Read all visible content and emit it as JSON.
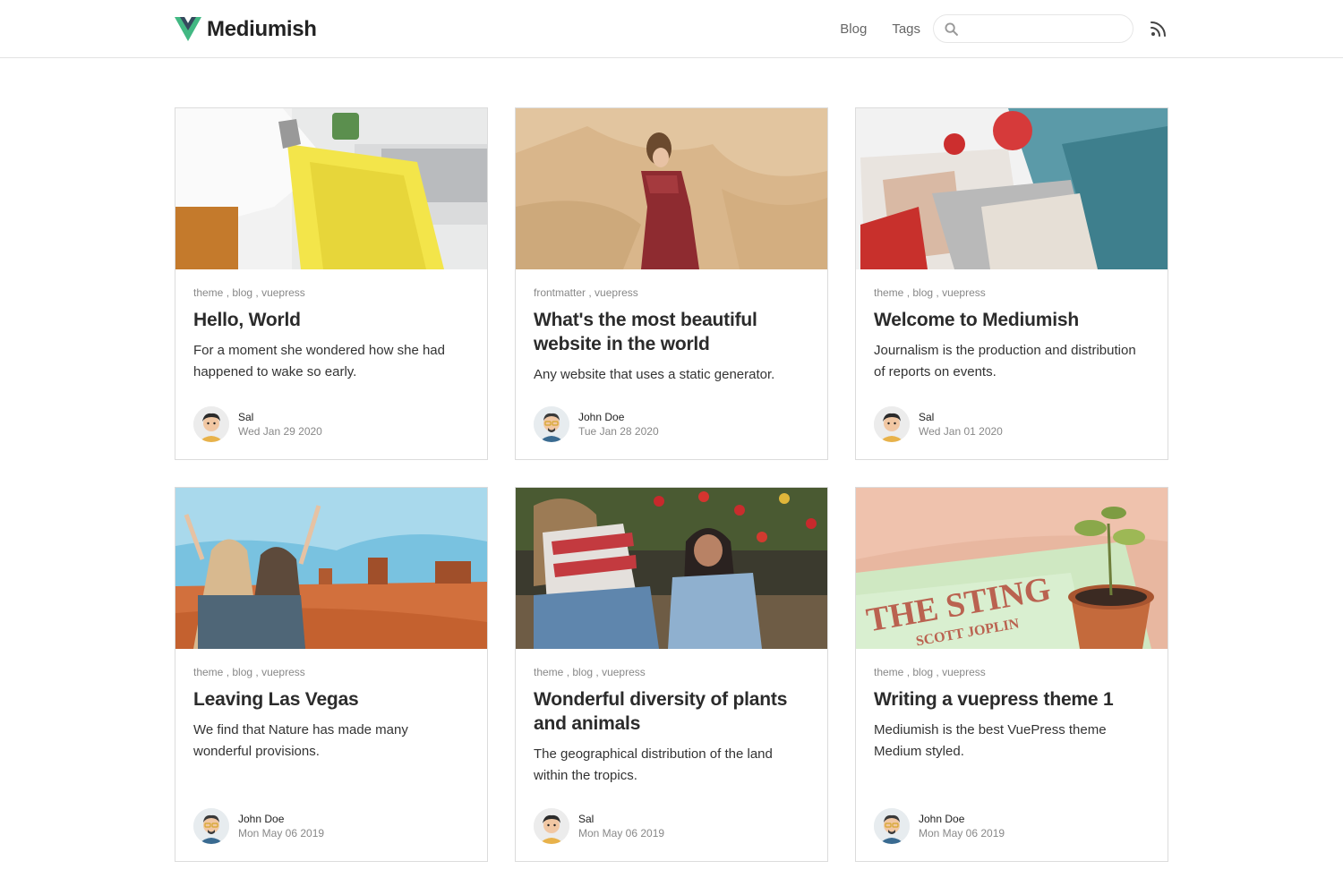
{
  "site": {
    "name": "Mediumish",
    "brand_color": "#42b883",
    "brand_dark": "#35495e"
  },
  "nav": {
    "links": [
      "Blog",
      "Tags"
    ],
    "search": {
      "value": "",
      "placeholder": ""
    },
    "rss_icon": "rss-icon"
  },
  "posts": [
    {
      "tags": [
        "theme",
        "blog",
        "vuepress"
      ],
      "title": "Hello, World",
      "excerpt": "For a moment she wondered how she had happened to wake so early.",
      "author": "Sal",
      "date": "Wed Jan 29 2020",
      "image": "person-reading-yellow-magazine"
    },
    {
      "tags": [
        "frontmatter",
        "vuepress"
      ],
      "title": "What's the most beautiful website in the world",
      "excerpt": "Any website that uses a static generator.",
      "author": "John Doe",
      "date": "Tue Jan 28 2020",
      "image": "girl-red-dress-sand-wall"
    },
    {
      "tags": [
        "theme",
        "blog",
        "vuepress"
      ],
      "title": "Welcome to Mediumish",
      "excerpt": "Journalism is the production and distribution of reports on events.",
      "author": "Sal",
      "date": "Wed Jan 01 2020",
      "image": "fashion-magazines"
    },
    {
      "tags": [
        "theme",
        "blog",
        "vuepress"
      ],
      "title": "Leaving Las Vegas",
      "excerpt": "We find that Nature has made many wonderful provisions.",
      "author": "John Doe",
      "date": "Mon May 06 2019",
      "image": "friends-desert-valley"
    },
    {
      "tags": [
        "theme",
        "blog",
        "vuepress"
      ],
      "title": "Wonderful diversity of plants and animals",
      "excerpt": "The geographical distribution of the land within the tropics.",
      "author": "Sal",
      "date": "Mon May 06 2019",
      "image": "girls-tulip-field"
    },
    {
      "tags": [
        "theme",
        "blog",
        "vuepress"
      ],
      "title": "Writing a vuepress theme 1",
      "excerpt": "Mediumish is the best VuePress theme Medium styled.",
      "author": "John Doe",
      "date": "Mon May 06 2019",
      "image": "the-sting-record-and-plant"
    }
  ]
}
